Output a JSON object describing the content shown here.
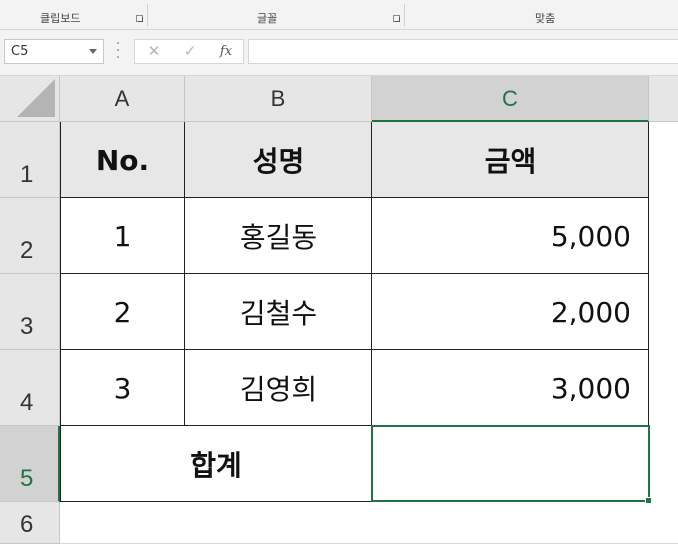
{
  "ribbon": {
    "groups": [
      {
        "label": "클립보드"
      },
      {
        "label": "글꼴"
      },
      {
        "label": "맞춤"
      }
    ]
  },
  "formula_bar": {
    "name_box": "C5",
    "cancel_icon": "✕",
    "enter_icon": "✓",
    "fx_label": "fx",
    "formula": ""
  },
  "sheet": {
    "columns": [
      "A",
      "B",
      "C"
    ],
    "rows": [
      "1",
      "2",
      "3",
      "4",
      "5",
      "6"
    ],
    "selected_cell": "C5",
    "headers": {
      "no": "No.",
      "name": "성명",
      "amount": "금액"
    },
    "records": [
      {
        "no": "1",
        "name": "홍길동",
        "amount": "5,000"
      },
      {
        "no": "2",
        "name": "김철수",
        "amount": "2,000"
      },
      {
        "no": "3",
        "name": "김영희",
        "amount": "3,000"
      }
    ],
    "total_label": "합계",
    "total_value": ""
  },
  "colors": {
    "accent": "#217346",
    "header_fill": "#e7e7e7",
    "grid_header": "#e6e6e6"
  }
}
